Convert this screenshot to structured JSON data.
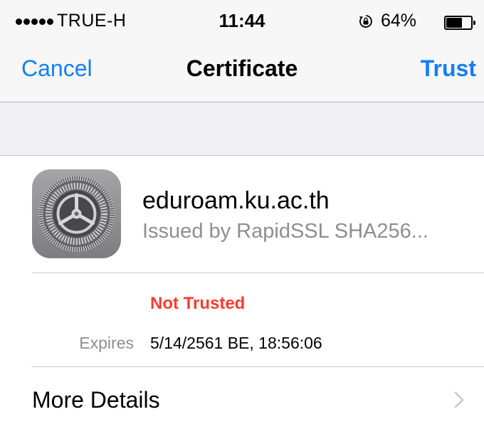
{
  "status_bar": {
    "carrier": "TRUE-H",
    "time": "11:44",
    "battery_text": "64%",
    "battery_level": 0.64,
    "icons": [
      "signal-dots-icon",
      "orientation-lock-icon",
      "battery-icon"
    ]
  },
  "nav": {
    "cancel_label": "Cancel",
    "title": "Certificate",
    "trust_label": "Trust"
  },
  "certificate": {
    "name": "eduroam.ku.ac.th",
    "issuer": "Issued by RapidSSL SHA256...",
    "icon": "settings-gear-icon",
    "status": "Not Trusted",
    "expires_label": "Expires",
    "expires_value": "5/14/2561 BE, 18:56:06"
  },
  "more_details_label": "More Details",
  "colors": {
    "accent": "#147efb",
    "danger": "#ff3b30",
    "secondary_text": "#8e8e93",
    "grouped_background": "#efeff4"
  }
}
